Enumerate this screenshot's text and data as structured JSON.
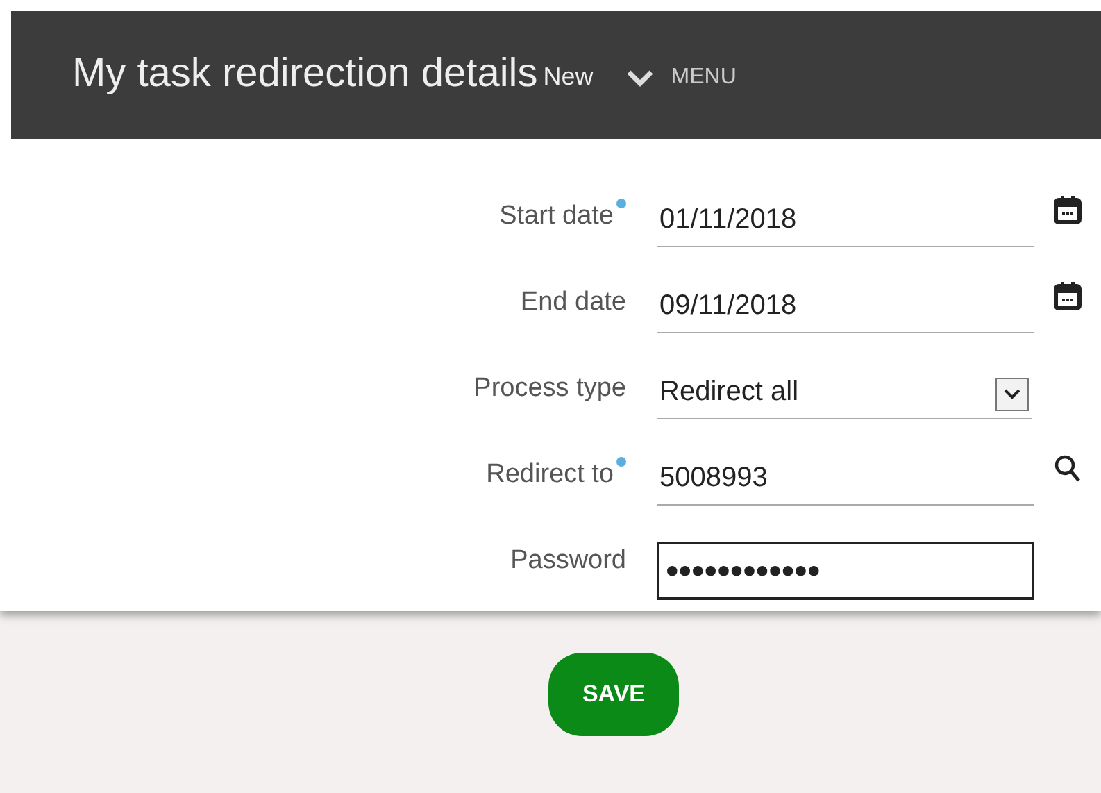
{
  "header": {
    "title": "My task redirection details",
    "badge": "New",
    "menu": "MENU"
  },
  "fields": [
    {
      "label": "Start date",
      "required": true,
      "kind": "date",
      "value": "01/11/2018"
    },
    {
      "label": "End date",
      "required": false,
      "kind": "date",
      "value": "09/11/2018"
    },
    {
      "label": "Process type",
      "required": false,
      "kind": "select",
      "value": "Redirect all"
    },
    {
      "label": "Redirect to",
      "required": true,
      "kind": "lookup",
      "value": "5008993"
    },
    {
      "label": "Password",
      "required": false,
      "kind": "password",
      "value": "●●●●●●●●●●●●"
    }
  ],
  "save": "SAVE"
}
